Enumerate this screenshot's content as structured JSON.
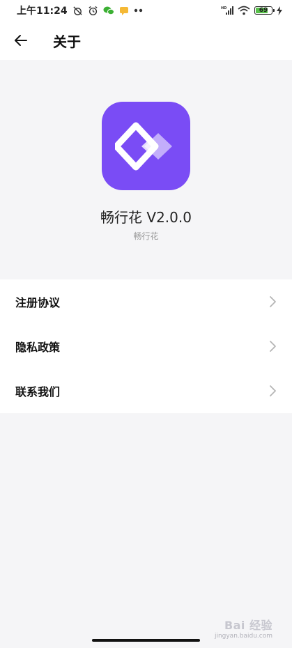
{
  "status_bar": {
    "time": "上午11:24",
    "battery_level": "69",
    "network_label": "HD",
    "icons": [
      "alarm-off-icon",
      "alarm-clock-icon",
      "wechat-icon",
      "message-icon",
      "more-dots-icon",
      "signal-icon",
      "wifi-icon",
      "battery-icon",
      "charging-icon"
    ]
  },
  "app_bar": {
    "title": "关于",
    "back_icon": "arrow-left-icon"
  },
  "about": {
    "app_version_text": "畅行花  V2.0.0",
    "app_subname": "畅行花",
    "icon_color": "#7a4cf5"
  },
  "menu": {
    "items": [
      {
        "label": "注册协议"
      },
      {
        "label": "隐私政策"
      },
      {
        "label": "联系我们"
      }
    ]
  },
  "watermark": {
    "main": "Bai 经验",
    "sub": "jingyan.baidu.com"
  }
}
